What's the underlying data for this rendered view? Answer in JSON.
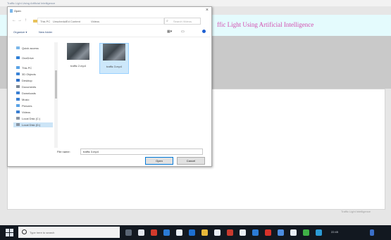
{
  "app": {
    "window_title": "Traffic Light Using Artificial Intelligence",
    "banner_title": "ffic Light Using Artificial Intelligence",
    "status_text": "Traffic Light Intelligence"
  },
  "dialog": {
    "title": "Open",
    "close_glyph": "×",
    "address": {
      "back": "←",
      "forward": "→",
      "up": "↑",
      "crumbs": [
        "This PC",
        "UnschedulEd Content",
        "Videos"
      ],
      "search_placeholder": "Search Videos"
    },
    "toolbar": {
      "organize": "Organize ▾",
      "new_folder": "New folder"
    },
    "nav_items": [
      {
        "label": "Quick access",
        "icon": "star-icon",
        "color": "#7bb7ea"
      },
      {
        "label": "OneDrive",
        "icon": "cloud-icon",
        "color": "#2f7fd6"
      },
      {
        "label": "This PC",
        "icon": "computer-icon",
        "color": "#5aa3e6"
      },
      {
        "label": "3D Objects",
        "icon": "cube-icon",
        "color": "#3b84d8"
      },
      {
        "label": "Desktop",
        "icon": "desktop-icon",
        "color": "#2d6fc8"
      },
      {
        "label": "Documents",
        "icon": "documents-icon",
        "color": "#7b8794"
      },
      {
        "label": "Downloads",
        "icon": "download-icon",
        "color": "#3a7fd2"
      },
      {
        "label": "Music",
        "icon": "music-icon",
        "color": "#3a7fd2"
      },
      {
        "label": "Pictures",
        "icon": "pictures-icon",
        "color": "#5aa3e6"
      },
      {
        "label": "Videos",
        "icon": "videos-icon",
        "color": "#3a7fd2"
      },
      {
        "label": "Local Disk (C:)",
        "icon": "drive-icon",
        "color": "#8a95a3"
      },
      {
        "label": "Local Disk (D:)",
        "icon": "drive-icon",
        "color": "#8a95a3"
      }
    ],
    "files": [
      {
        "name": "traffic 2.mp4"
      },
      {
        "name": "traffic 3.mp4"
      }
    ],
    "file_name_label": "File name:",
    "file_name_value": "traffic 3.mp4",
    "open_label": "Open",
    "cancel_label": "Cancel"
  },
  "taskbar": {
    "search_placeholder": "Type here to search",
    "time": "22:45"
  }
}
